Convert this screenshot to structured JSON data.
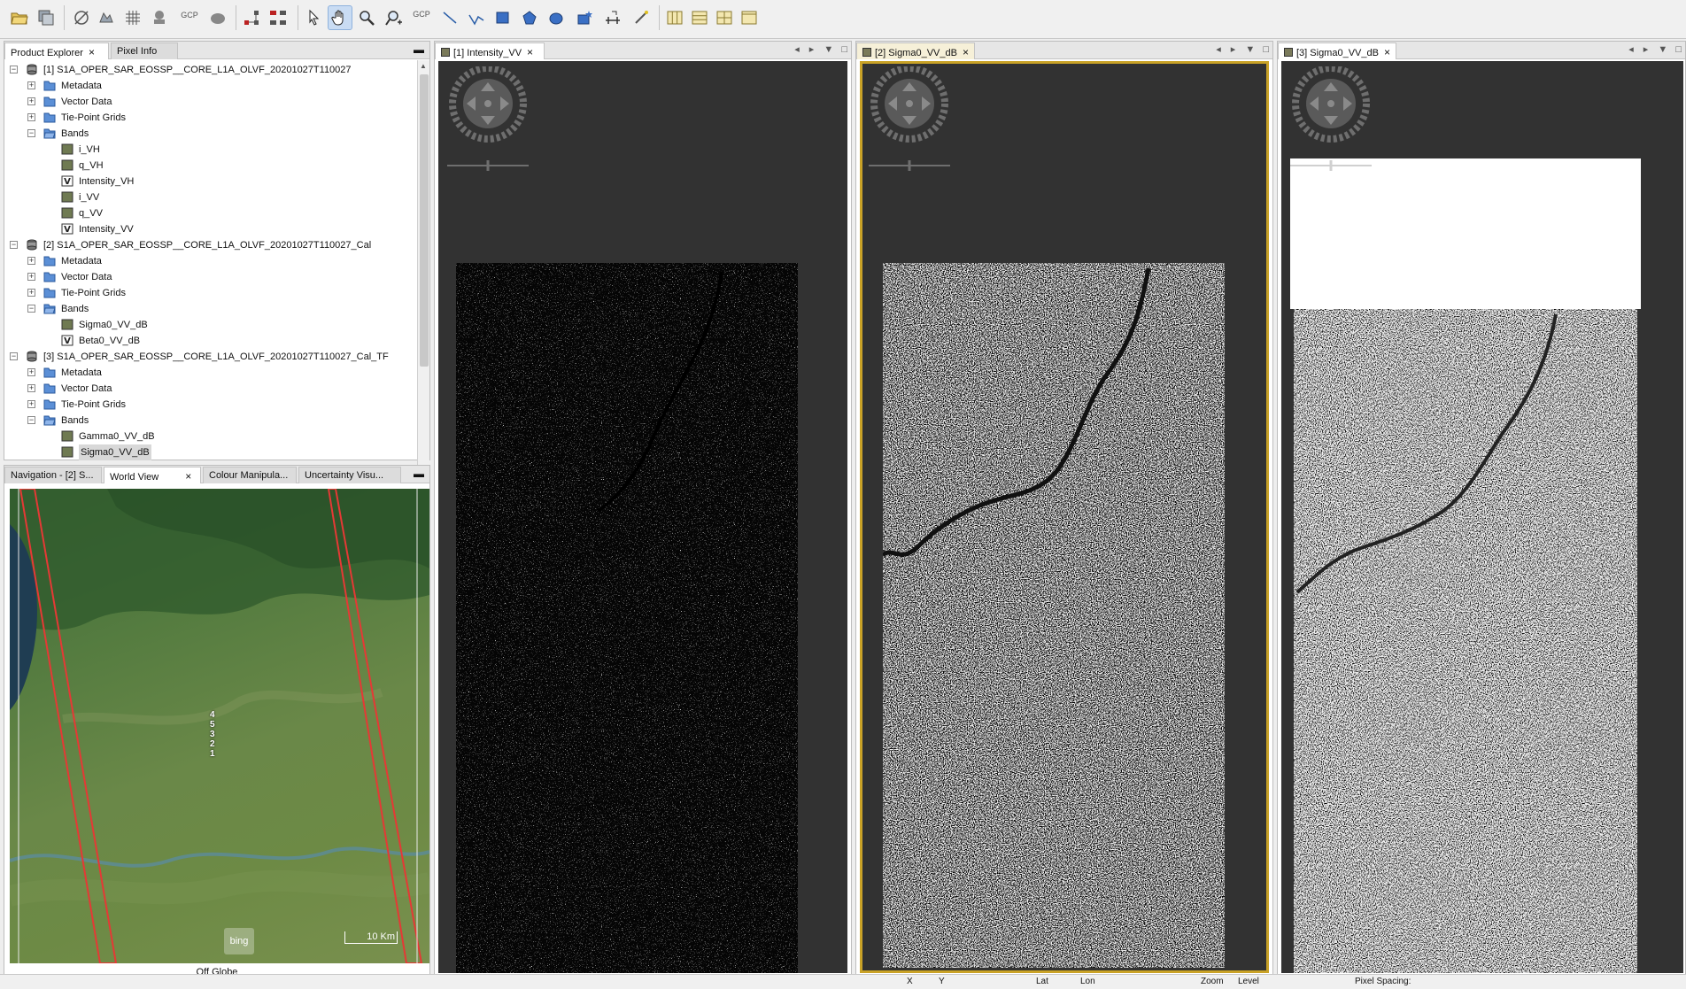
{
  "toolbar": {
    "gcp_label_1": "GCP",
    "gcp_label_2": "GCP"
  },
  "product_explorer": {
    "tabs": [
      {
        "label": "Product Explorer"
      },
      {
        "label": "Pixel Info"
      }
    ],
    "tree": [
      {
        "level": 0,
        "type": "product",
        "label": "[1] S1A_OPER_SAR_EOSSP__CORE_L1A_OLVF_20201027T110027"
      },
      {
        "level": 1,
        "type": "folder",
        "label": "Metadata"
      },
      {
        "level": 1,
        "type": "folder",
        "label": "Vector Data"
      },
      {
        "level": 1,
        "type": "folder",
        "label": "Tie-Point Grids"
      },
      {
        "level": 1,
        "type": "folder-open",
        "label": "Bands"
      },
      {
        "level": 2,
        "type": "band",
        "label": "i_VH"
      },
      {
        "level": 2,
        "type": "band",
        "label": "q_VH"
      },
      {
        "level": 2,
        "type": "vband",
        "label": "Intensity_VH"
      },
      {
        "level": 2,
        "type": "band",
        "label": "i_VV"
      },
      {
        "level": 2,
        "type": "band",
        "label": "q_VV"
      },
      {
        "level": 2,
        "type": "vband",
        "label": "Intensity_VV"
      },
      {
        "level": 0,
        "type": "product",
        "label": "[2] S1A_OPER_SAR_EOSSP__CORE_L1A_OLVF_20201027T110027_Cal"
      },
      {
        "level": 1,
        "type": "folder",
        "label": "Metadata"
      },
      {
        "level": 1,
        "type": "folder",
        "label": "Vector Data"
      },
      {
        "level": 1,
        "type": "folder",
        "label": "Tie-Point Grids"
      },
      {
        "level": 1,
        "type": "folder-open",
        "label": "Bands"
      },
      {
        "level": 2,
        "type": "band",
        "label": "Sigma0_VV_dB"
      },
      {
        "level": 2,
        "type": "vband",
        "label": "Beta0_VV_dB"
      },
      {
        "level": 0,
        "type": "product",
        "label": "[3] S1A_OPER_SAR_EOSSP__CORE_L1A_OLVF_20201027T110027_Cal_TF"
      },
      {
        "level": 1,
        "type": "folder",
        "label": "Metadata"
      },
      {
        "level": 1,
        "type": "folder",
        "label": "Vector Data"
      },
      {
        "level": 1,
        "type": "folder",
        "label": "Tie-Point Grids"
      },
      {
        "level": 1,
        "type": "folder-open",
        "label": "Bands"
      },
      {
        "level": 2,
        "type": "band",
        "label": "Gamma0_VV_dB"
      },
      {
        "level": 2,
        "type": "band",
        "label": "Sigma0_VV_dB",
        "selected": true
      }
    ]
  },
  "world_view_panel": {
    "tabs": [
      {
        "label": "Navigation - [2] S..."
      },
      {
        "label": "World View"
      },
      {
        "label": "Colour Manipula..."
      },
      {
        "label": "Uncertainty Visu..."
      }
    ],
    "scale_label": "10 Km",
    "labels": [
      "4",
      "5",
      "3",
      "2",
      "1"
    ],
    "bing_label": "bing",
    "status": "Off Globe"
  },
  "views": [
    {
      "tab": "[1] Intensity_VV"
    },
    {
      "tab": "[2] Sigma0_VV_dB"
    },
    {
      "tab": "[3] Sigma0_VV_dB"
    }
  ],
  "status_bar": {
    "x_label": "X",
    "y_label": "Y",
    "lat_label": "Lat",
    "lon_label": "Lon",
    "zoom_label": "Zoom",
    "level_label": "Level",
    "pixel_spacing_label": "Pixel Spacing:"
  },
  "colors": {
    "active_view_border": "#c9a227",
    "viewer_background": "#323232",
    "footprint": "#e53935"
  }
}
